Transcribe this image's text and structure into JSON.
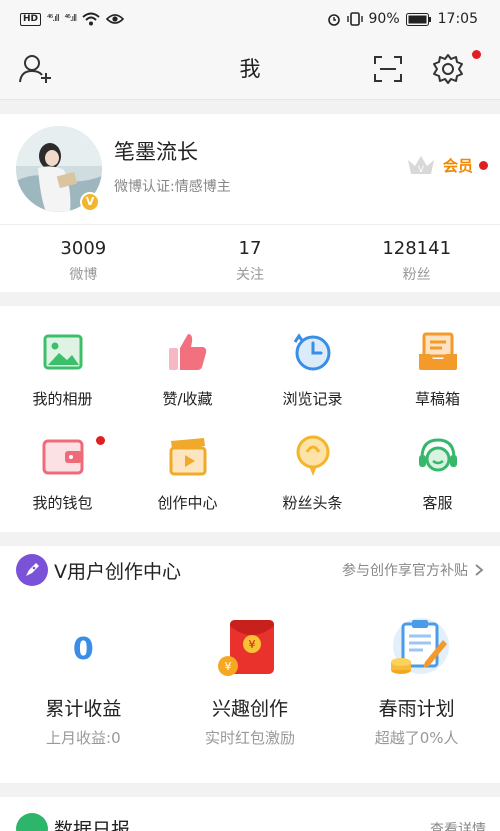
{
  "status_bar": {
    "hd": "HD",
    "signal1": "⁴⁶.ıll",
    "signal2": "⁴⁶.ıll",
    "battery_pct": "90%",
    "time": "17:05"
  },
  "nav": {
    "title": "我",
    "icons": [
      "add-friend-icon",
      "scan-icon",
      "settings-icon"
    ]
  },
  "profile": {
    "username": "笔墨流长",
    "verified_text": "微博认证:情感博主",
    "avatar_badge": "V",
    "vip_label": "会员",
    "stats": [
      {
        "num": "3009",
        "label": "微博"
      },
      {
        "num": "17",
        "label": "关注"
      },
      {
        "num": "128141",
        "label": "粉丝"
      }
    ]
  },
  "grid": {
    "items": [
      {
        "label": "我的相册",
        "icon": "album-icon"
      },
      {
        "label": "赞/收藏",
        "icon": "thumbs-up-icon"
      },
      {
        "label": "浏览记录",
        "icon": "history-clock-icon"
      },
      {
        "label": "草稿箱",
        "icon": "drafts-tray-icon"
      },
      {
        "label": "我的钱包",
        "icon": "wallet-icon"
      },
      {
        "label": "创作中心",
        "icon": "clapperboard-icon"
      },
      {
        "label": "粉丝头条",
        "icon": "headline-bulb-icon"
      },
      {
        "label": "客服",
        "icon": "customer-service-icon"
      }
    ]
  },
  "creator": {
    "title": "V用户创作中心",
    "link": "参与创作享官方补贴",
    "earnings_value": "0",
    "columns": [
      {
        "name": "累计收益",
        "sub": "上月收益:0"
      },
      {
        "name": "兴趣创作",
        "sub": "实时红包激励"
      },
      {
        "name": "春雨计划",
        "sub": "超越了0%人"
      }
    ]
  },
  "data_report": {
    "title": "数据日报",
    "link": "查看详情"
  },
  "colors": {
    "accent_blue": "#3a8ee6",
    "vip_orange": "#f08800",
    "notify_red": "#e02020"
  }
}
